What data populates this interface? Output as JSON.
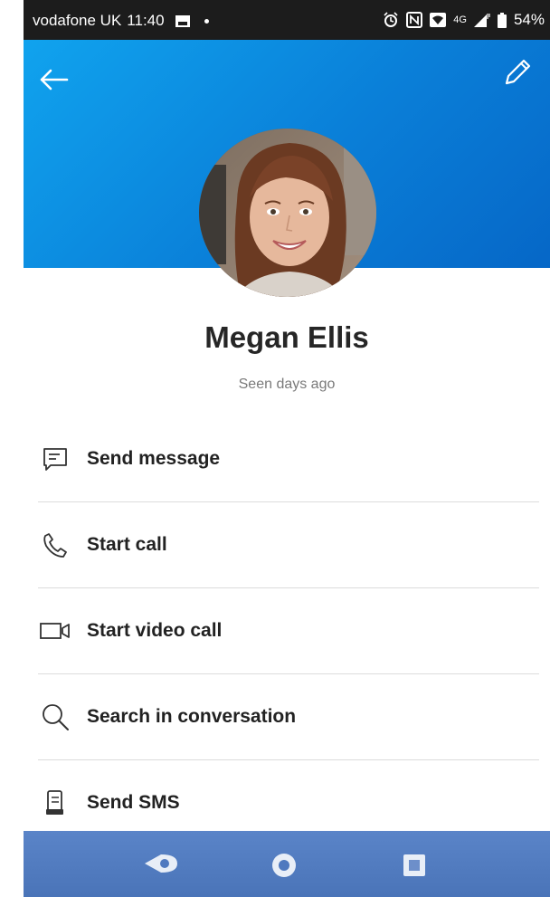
{
  "status_bar": {
    "carrier": "vodafone UK",
    "time": "11:40",
    "network": "4G",
    "battery": "54%"
  },
  "header": {
    "back_icon": "arrow-left-icon",
    "edit_icon": "pencil-icon",
    "gradient_start": "#10a3ee",
    "gradient_end": "#0667c7"
  },
  "profile": {
    "name": "Megan Ellis",
    "presence": "Seen days ago"
  },
  "actions": [
    {
      "label": "Send message",
      "icon": "message-icon"
    },
    {
      "label": "Start call",
      "icon": "phone-icon"
    },
    {
      "label": "Start video call",
      "icon": "video-camera-icon"
    },
    {
      "label": "Search in conversation",
      "icon": "search-icon"
    },
    {
      "label": "Send SMS",
      "icon": "sms-icon"
    }
  ],
  "nav_bar": {
    "color": "#4f79bf",
    "buttons": [
      "back-icon",
      "home-icon",
      "recents-icon"
    ]
  }
}
